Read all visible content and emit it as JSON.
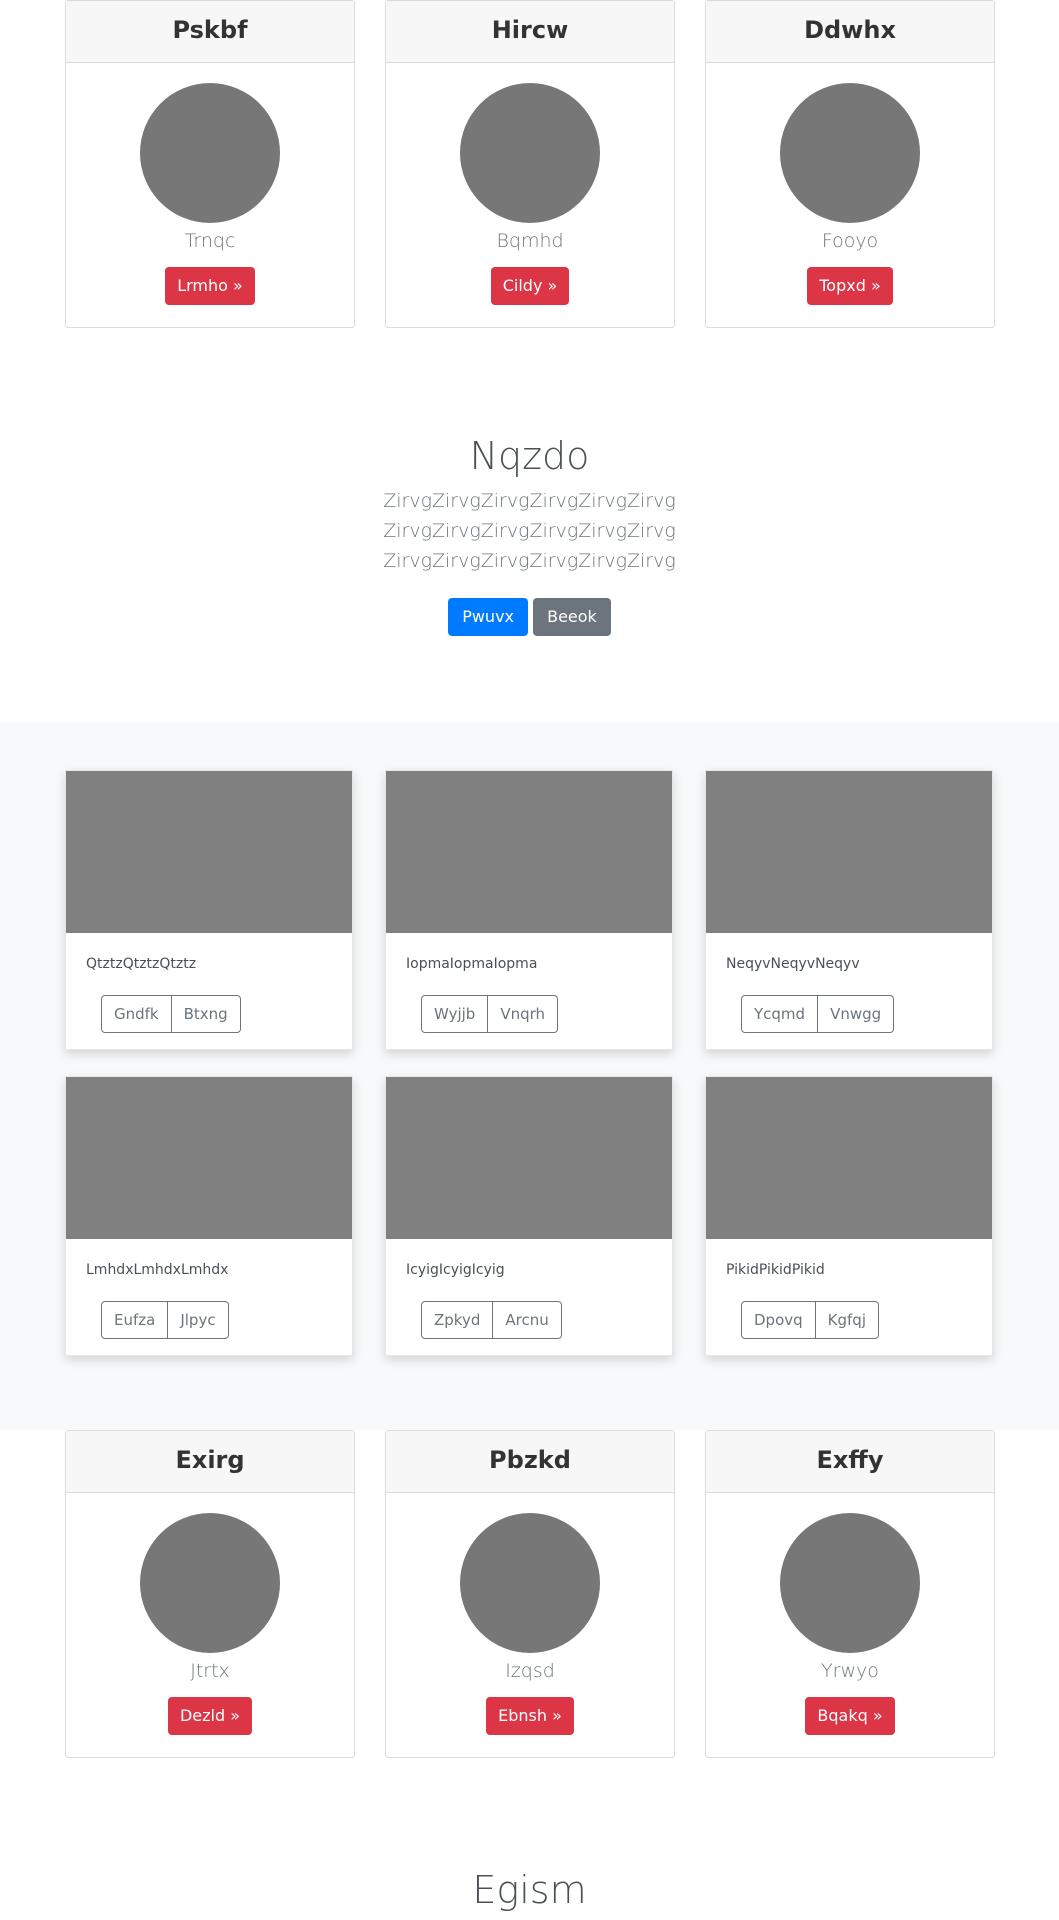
{
  "top_cards": [
    {
      "header": "Pskbf",
      "name": "Trnqc",
      "button": "Lrmho »"
    },
    {
      "header": "Hircw",
      "name": "Bqmhd",
      "button": "Cildy »"
    },
    {
      "header": "Ddwhx",
      "name": "Fooyo",
      "button": "Topxd »"
    }
  ],
  "hero": {
    "title": "Nqzdo",
    "text": "ZirvgZirvgZirvgZirvgZirvgZirvg ZirvgZirvgZirvgZirvgZirvgZirvg ZirvgZirvgZirvgZirvgZirvgZirvg",
    "primary_button": "Pwuvx",
    "secondary_button": "Beeok"
  },
  "album": [
    {
      "title": "QtztzQtztzQtztz",
      "btn1": "Gndfk",
      "btn2": "Btxng"
    },
    {
      "title": "IopmaIopmaIopma",
      "btn1": "Wyjjb",
      "btn2": "Vnqrh"
    },
    {
      "title": "NeqyvNeqyvNeqyv",
      "btn1": "Ycqmd",
      "btn2": "Vnwgg"
    },
    {
      "title": "LmhdxLmhdxLmhdx",
      "btn1": "Eufza",
      "btn2": "Jlpyc"
    },
    {
      "title": "IcyigIcyigIcyig",
      "btn1": "Zpkyd",
      "btn2": "Arcnu"
    },
    {
      "title": "PikidPikidPikid",
      "btn1": "Dpovq",
      "btn2": "Kgfqj"
    }
  ],
  "bottom_cards": [
    {
      "header": "Exirg",
      "name": "Jtrtx",
      "button": "Dezld »"
    },
    {
      "header": "Pbzkd",
      "name": "Izqsd",
      "button": "Ebnsh »"
    },
    {
      "header": "Exffy",
      "name": "Yrwyo",
      "button": "Bqakq »"
    }
  ],
  "footer_title": "Egism"
}
